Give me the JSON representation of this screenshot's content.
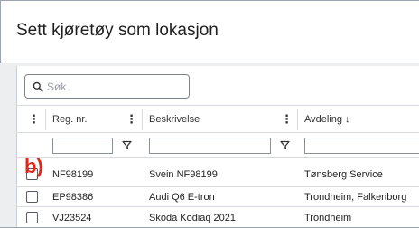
{
  "dialog": {
    "title": "Sett kjøretøy som lokasjon"
  },
  "search": {
    "placeholder": "Søk"
  },
  "table": {
    "columns": [
      {
        "label": "Reg. nr."
      },
      {
        "label": "Beskrivelse"
      },
      {
        "label": "Avdeling ↓"
      }
    ],
    "rows": [
      {
        "reg": "NF98199",
        "description": "Svein NF98199",
        "department": "Tønsberg Service"
      },
      {
        "reg": "EP98386",
        "description": "Audi Q6 E-tron",
        "department": "Trondheim, Falkenborg"
      },
      {
        "reg": "VJ23524",
        "description": "Skoda Kodiaq 2021",
        "department": "Trondheim"
      }
    ]
  },
  "annotation": {
    "label": "b)",
    "color": "#e1261c"
  }
}
